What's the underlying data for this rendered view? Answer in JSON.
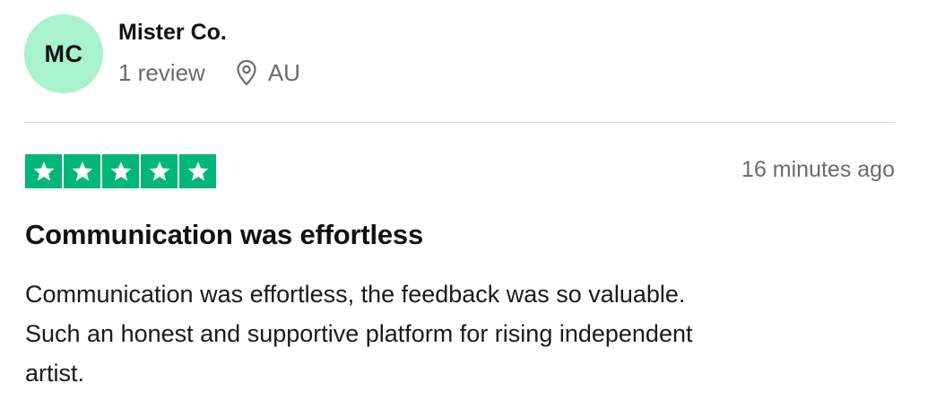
{
  "reviewer": {
    "initials": "MC",
    "name": "Mister Co.",
    "review_count": "1 review",
    "country": "AU"
  },
  "rating": {
    "stars": 5,
    "max_stars": 5,
    "star_color": "#00b67a",
    "star_icon": "star-icon"
  },
  "timestamp": "16 minutes ago",
  "review": {
    "title": "Communication was effortless",
    "body_lines": [
      "Communication was effortless, the feedback was so valuable.",
      "Such an honest and supportive platform for rising independent",
      "artist."
    ]
  },
  "colors": {
    "avatar_bg": "#a8f2cd",
    "muted_text": "#6b6b6b",
    "divider": "#dcdce0"
  }
}
